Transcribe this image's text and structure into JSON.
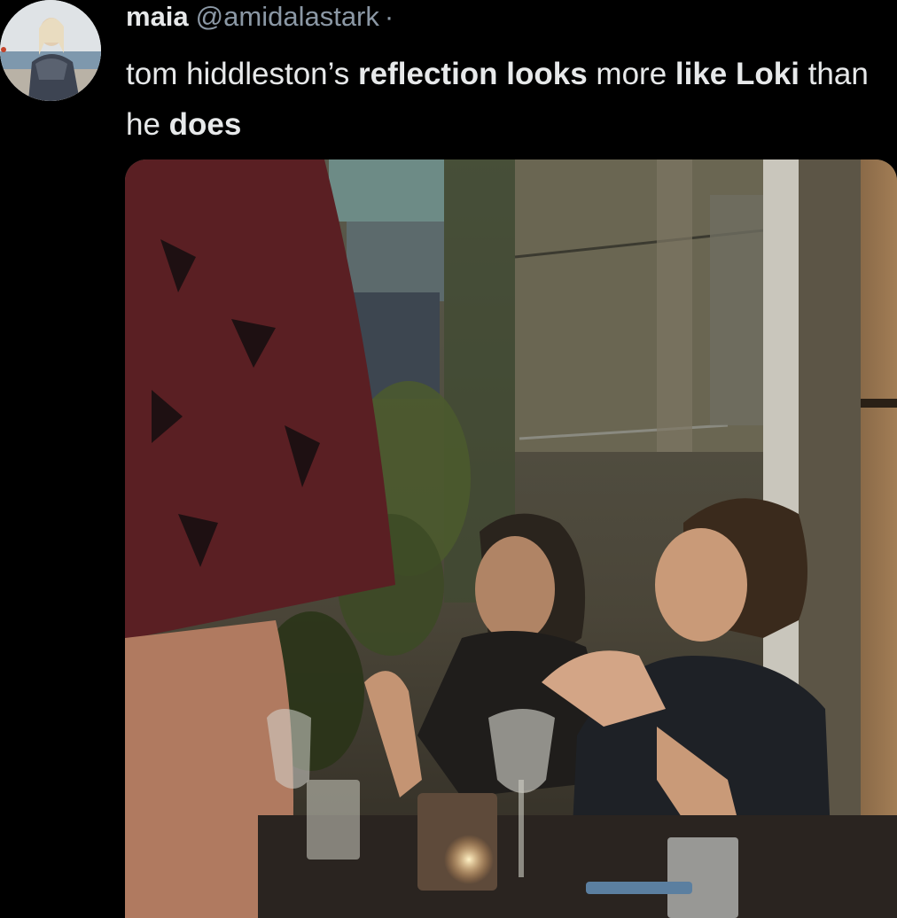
{
  "tweet": {
    "author": {
      "display_name": "maia",
      "handle": "@amidalastark",
      "separator": "·",
      "avatar_icon": "profile-avatar"
    },
    "text_segments": [
      {
        "text": "tom hiddleston’s ",
        "bold": false
      },
      {
        "text": "reflection looks",
        "bold": true
      },
      {
        "text": " more ",
        "bold": false
      },
      {
        "text": "like",
        "bold": true
      },
      {
        "text": " ",
        "bold": false
      },
      {
        "text": "Loki",
        "bold": true
      },
      {
        "text": " than he ",
        "bold": false
      },
      {
        "text": "does",
        "bold": true
      }
    ],
    "media": {
      "type": "photo"
    }
  },
  "colors": {
    "background": "#000000",
    "text_primary": "#e7e9ea",
    "text_secondary": "#8b98a5"
  }
}
